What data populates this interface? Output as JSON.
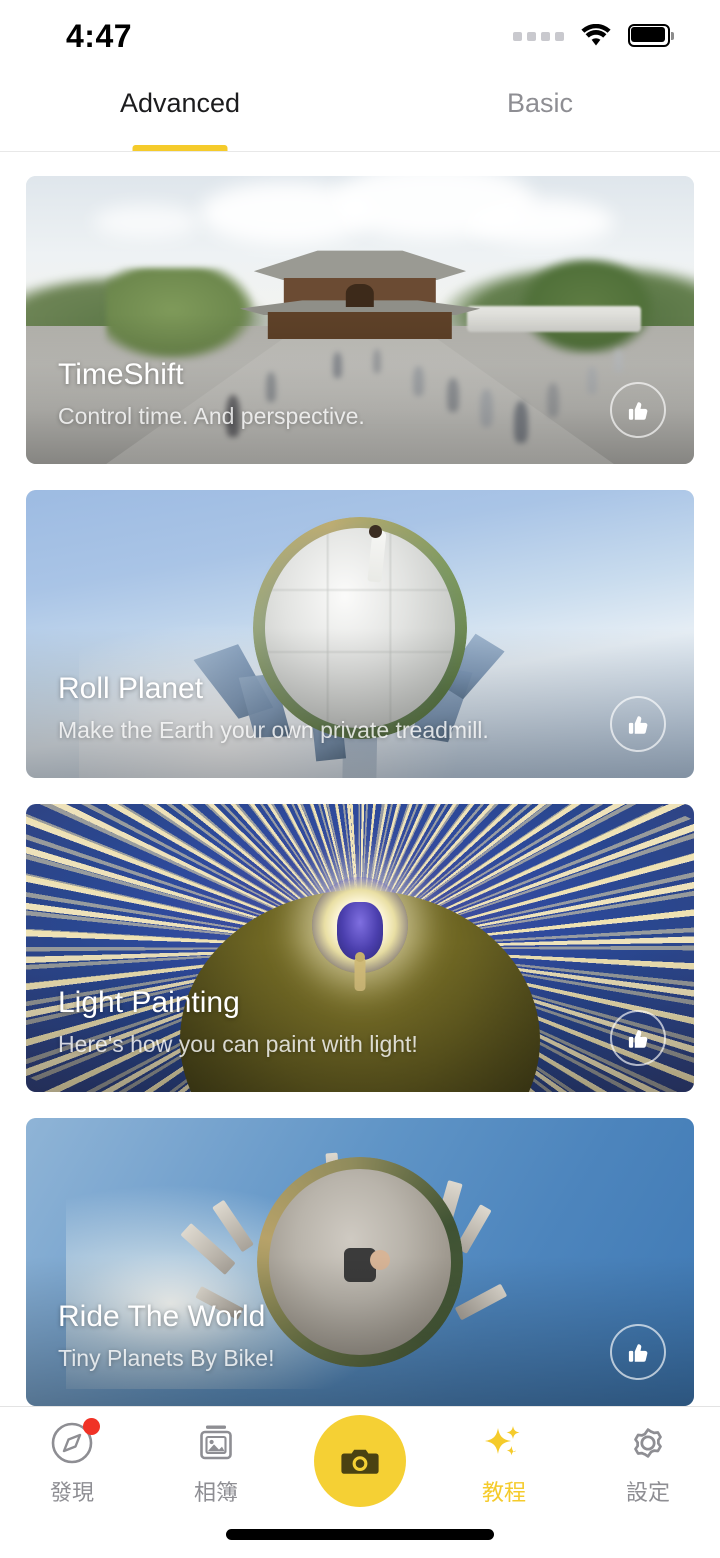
{
  "status_bar": {
    "time": "4:47",
    "signal_icon": "signal-dots-icon",
    "wifi_icon": "wifi-icon",
    "battery_icon": "battery-full-icon"
  },
  "tabs": {
    "items": [
      {
        "label": "Advanced",
        "active": true
      },
      {
        "label": "Basic",
        "active": false
      }
    ],
    "active_underline_color": "#F5CB2B"
  },
  "cards": [
    {
      "title": "TimeShift",
      "subtitle": "Control time. And perspective.",
      "like_icon": "thumbs-up-icon",
      "art": "temple-timelapse"
    },
    {
      "title": "Roll Planet",
      "subtitle": "Make the Earth your own private treadmill.",
      "like_icon": "thumbs-up-icon",
      "art": "tiny-planet-plaza"
    },
    {
      "title": "Light Painting",
      "subtitle": "Here's how you can paint with light!",
      "like_icon": "thumbs-up-icon",
      "art": "light-painting-planet"
    },
    {
      "title": "Ride The World",
      "subtitle": "Tiny Planets By Bike!",
      "like_icon": "thumbs-up-icon",
      "art": "tiny-planet-city-bike"
    }
  ],
  "tabbar": {
    "items": [
      {
        "label": "發現",
        "icon": "compass-icon",
        "active": false,
        "badge": true
      },
      {
        "label": "相簿",
        "icon": "photo-album-icon",
        "active": false,
        "badge": false
      },
      {
        "label": "教程",
        "icon": "sparkles-icon",
        "active": true,
        "badge": false
      },
      {
        "label": "設定",
        "icon": "gear-icon",
        "active": false,
        "badge": false
      }
    ],
    "camera_button": {
      "icon": "camera-icon",
      "color": "#F5D034"
    },
    "active_color": "#F5CB2B",
    "inactive_color": "#8E8E93"
  }
}
